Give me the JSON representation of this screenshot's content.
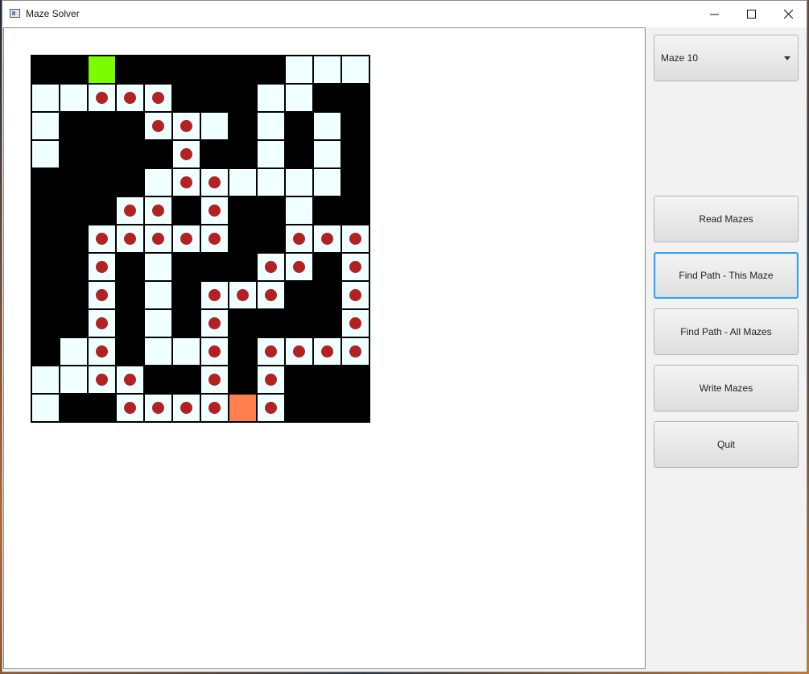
{
  "window": {
    "title": "Maze Solver",
    "controls": [
      "minimize-icon",
      "maximize-icon",
      "close-icon"
    ]
  },
  "maze_select": {
    "selected": "Maze 10"
  },
  "buttons": {
    "read": "Read Mazes",
    "find_this": "Find Path - This Maze",
    "find_all": "Find Path - All Mazes",
    "write": "Write Mazes",
    "quit": "Quit"
  },
  "colors": {
    "wall": "#000000",
    "open": "#F0FFFF",
    "start": "#7CFC00",
    "end": "#FF7F50",
    "path_dot": "#B22222",
    "focus_border": "#3AA0E8"
  },
  "maze": {
    "rows": 13,
    "cols": 12,
    "legend_codes": "W=wall, O=open, P=path dot, S=start, E=end",
    "grid": [
      "WWSWWWWWWOOO",
      "OOPPPWWWOOWW",
      "OWWWPPOWOWOW",
      "OWWWWPWWOWOW",
      "WWWWOPPOOOOW",
      "WWWPPWPWWOWW",
      "WWPPPPPWWPPP",
      "WWPWOWWWPPWP",
      "WWPWOWPPPWWP",
      "WWPWOWPWWWWP",
      "WOPWOOPWPPPP",
      "OOPPWWPWPWWW",
      "OWWPPPPEPWWW"
    ]
  }
}
